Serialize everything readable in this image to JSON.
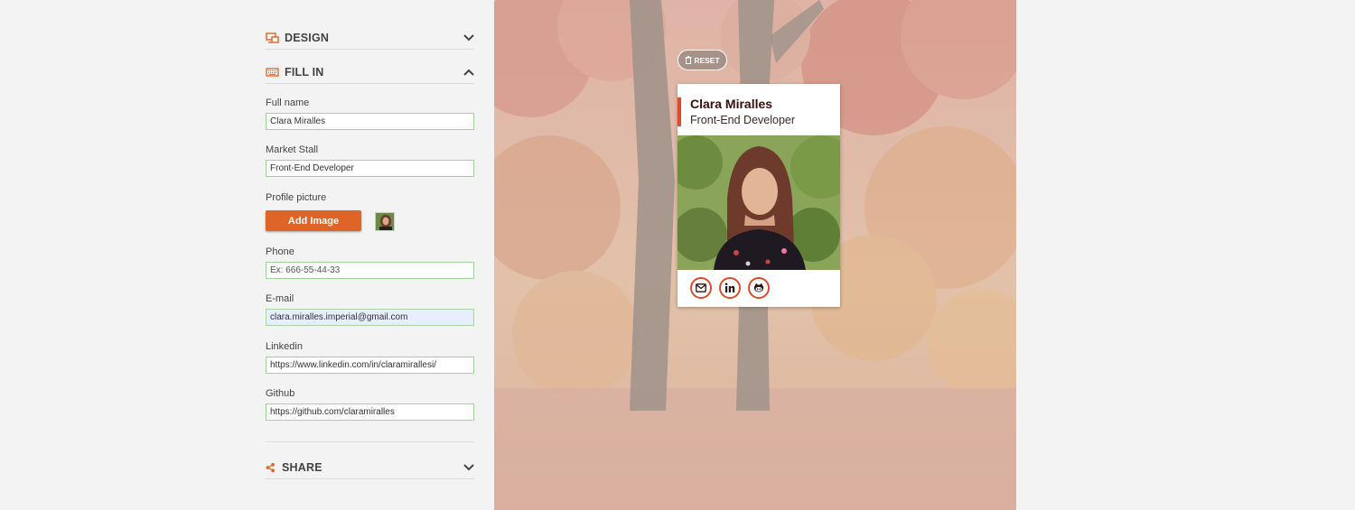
{
  "sections": {
    "design": {
      "label": "DESIGN",
      "icon": "design-icon",
      "state": "collapsed"
    },
    "fill_in": {
      "label": "FILL IN",
      "icon": "keyboard-icon",
      "state": "expanded"
    },
    "share": {
      "label": "SHARE",
      "icon": "share-icon",
      "state": "collapsed"
    }
  },
  "form": {
    "full_name": {
      "label": "Full name",
      "value": "Clara Miralles"
    },
    "market_stall": {
      "label": "Market Stall",
      "value": "Front-End Developer"
    },
    "profile_picture": {
      "label": "Profile picture",
      "button": "Add Image"
    },
    "phone": {
      "label": "Phone",
      "value": "",
      "placeholder": "Ex: 666-55-44-33"
    },
    "email": {
      "label": "E-mail",
      "value": "clara.miralles.imperial@gmail.com"
    },
    "linkedin": {
      "label": "Linkedin",
      "value": "https://www.linkedin.com/in/claramirallesi/"
    },
    "github": {
      "label": "Github",
      "value": "https://github.com/claramiralles"
    }
  },
  "preview": {
    "reset_label": "RESET",
    "card": {
      "name": "Clara Miralles",
      "job": "Front-End Developer",
      "socials": [
        "mail-icon",
        "linkedin-icon",
        "github-icon"
      ]
    }
  },
  "colors": {
    "accent": "#df6427",
    "card_accent": "#e0492b",
    "valid_border": "#9fd39a"
  }
}
